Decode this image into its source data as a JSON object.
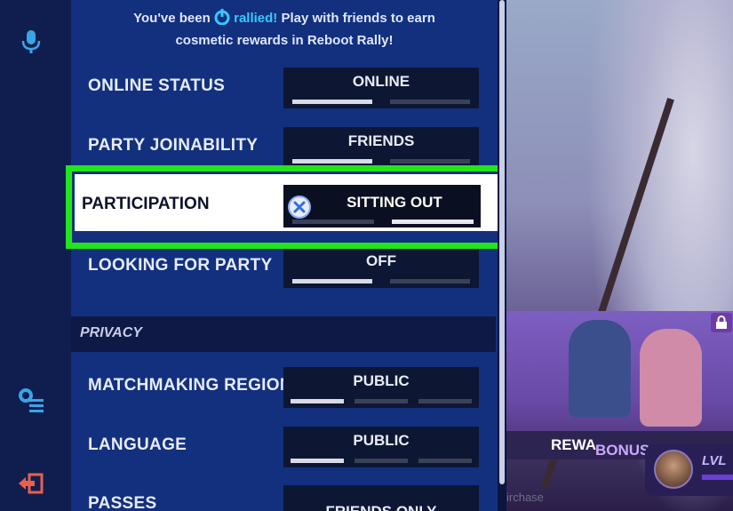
{
  "banner": {
    "prefix": "You've been",
    "rallied": "rallied!",
    "line1_rest": "Play with friends to earn",
    "line2": "cosmetic rewards in Reboot Rally!"
  },
  "settings": [
    {
      "label": "ONLINE STATUS",
      "value": "ONLINE",
      "segments": 2,
      "selected_segment": 1
    },
    {
      "label": "PARTY JOINABILITY",
      "value": "FRIENDS",
      "segments": 2,
      "selected_segment": 1
    },
    {
      "label": "PARTICIPATION",
      "value": "SITTING OUT",
      "segments": 2,
      "selected_segment": 2
    },
    {
      "label": "LOOKING FOR PARTY",
      "value": "OFF",
      "segments": 2,
      "selected_segment": 1
    }
  ],
  "privacy_section": "PRIVACY",
  "privacy_settings": [
    {
      "label": "MATCHMAKING REGION",
      "value": "PUBLIC",
      "segments": 3,
      "selected_segment": 1
    },
    {
      "label": "LANGUAGE",
      "value": "PUBLIC",
      "segments": 3,
      "selected_segment": 1
    },
    {
      "label": "PASSES",
      "value": "FRIENDS ONLY"
    }
  ],
  "art": {
    "bonus_label_1": "BONUS",
    "bonus_label_2": "REWA",
    "purchase_text": "irchase",
    "level_label": "LVL"
  },
  "colors": {
    "panel": "#12307e",
    "highlight_border": "#22e51b",
    "accent": "#36c9ff"
  },
  "icons": [
    "microphone-icon",
    "settings-list-icon",
    "exit-icon",
    "rally-icon",
    "close-icon",
    "lock-icon"
  ]
}
